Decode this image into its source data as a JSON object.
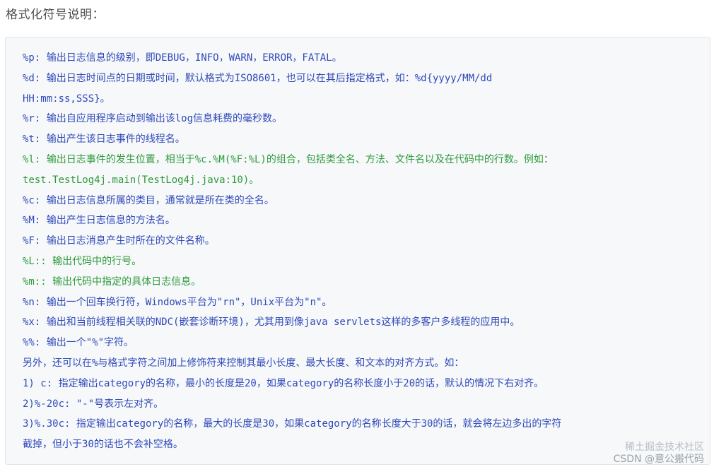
{
  "heading": "格式化符号说明：",
  "code_lines": [
    {
      "text": "%p: 输出日志信息的级别，即DEBUG，INFO，WARN，ERROR，FATAL。",
      "color": "blue"
    },
    {
      "text": "%d: 输出日志时间点的日期或时间，默认格式为ISO8601，也可以在其后指定格式，如：%d{yyyy/MM/dd",
      "color": "blue"
    },
    {
      "text": "HH:mm:ss,SSS}。",
      "color": "blue"
    },
    {
      "text": "%r: 输出自应用程序启动到输出该log信息耗费的毫秒数。",
      "color": "blue"
    },
    {
      "text": "%t: 输出产生该日志事件的线程名。",
      "color": "blue"
    },
    {
      "text": "%l: 输出日志事件的发生位置，相当于%c.%M(%F:%L)的组合，包括类全名、方法、文件名以及在代码中的行数。例如：",
      "color": "green"
    },
    {
      "text": "test.TestLog4j.main(TestLog4j.java:10)。",
      "color": "green"
    },
    {
      "text": "%c: 输出日志信息所属的类目，通常就是所在类的全名。",
      "color": "blue"
    },
    {
      "text": "%M: 输出产生日志信息的方法名。",
      "color": "blue"
    },
    {
      "text": "%F: 输出日志消息产生时所在的文件名称。",
      "color": "blue"
    },
    {
      "text": "%L:: 输出代码中的行号。",
      "color": "green"
    },
    {
      "text": "%m:: 输出代码中指定的具体日志信息。",
      "color": "green"
    },
    {
      "text": "%n: 输出一个回车换行符，Windows平台为\"rn\"，Unix平台为\"n\"。",
      "color": "blue"
    },
    {
      "text": "%x: 输出和当前线程相关联的NDC(嵌套诊断环境)，尤其用到像java servlets这样的多客户多线程的应用中。",
      "color": "blue"
    },
    {
      "text": "%%: 输出一个\"%\"字符。",
      "color": "blue"
    },
    {
      "text": "另外，还可以在%与格式字符之间加上修饰符来控制其最小长度、最大长度、和文本的对齐方式。如：",
      "color": "blue"
    },
    {
      "text": "1) c: 指定输出category的名称，最小的长度是20，如果category的名称长度小于20的话，默认的情况下右对齐。",
      "color": "blue"
    },
    {
      "text": "2)%-20c: \"-\"号表示左对齐。",
      "color": "blue"
    },
    {
      "text": "3)%.30c: 指定输出category的名称，最大的长度是30，如果category的名称长度大于30的话，就会将左边多出的字符",
      "color": "blue"
    },
    {
      "text": "截掉，但小于30的话也不会补空格。",
      "color": "blue"
    }
  ],
  "watermark": {
    "line1": "稀土掘金技术社区",
    "line2": "CSDN @意公搬代码"
  },
  "colors": {
    "blue": "#2f49b9",
    "green": "#2f9a3a",
    "background": "#f6f8fa"
  }
}
